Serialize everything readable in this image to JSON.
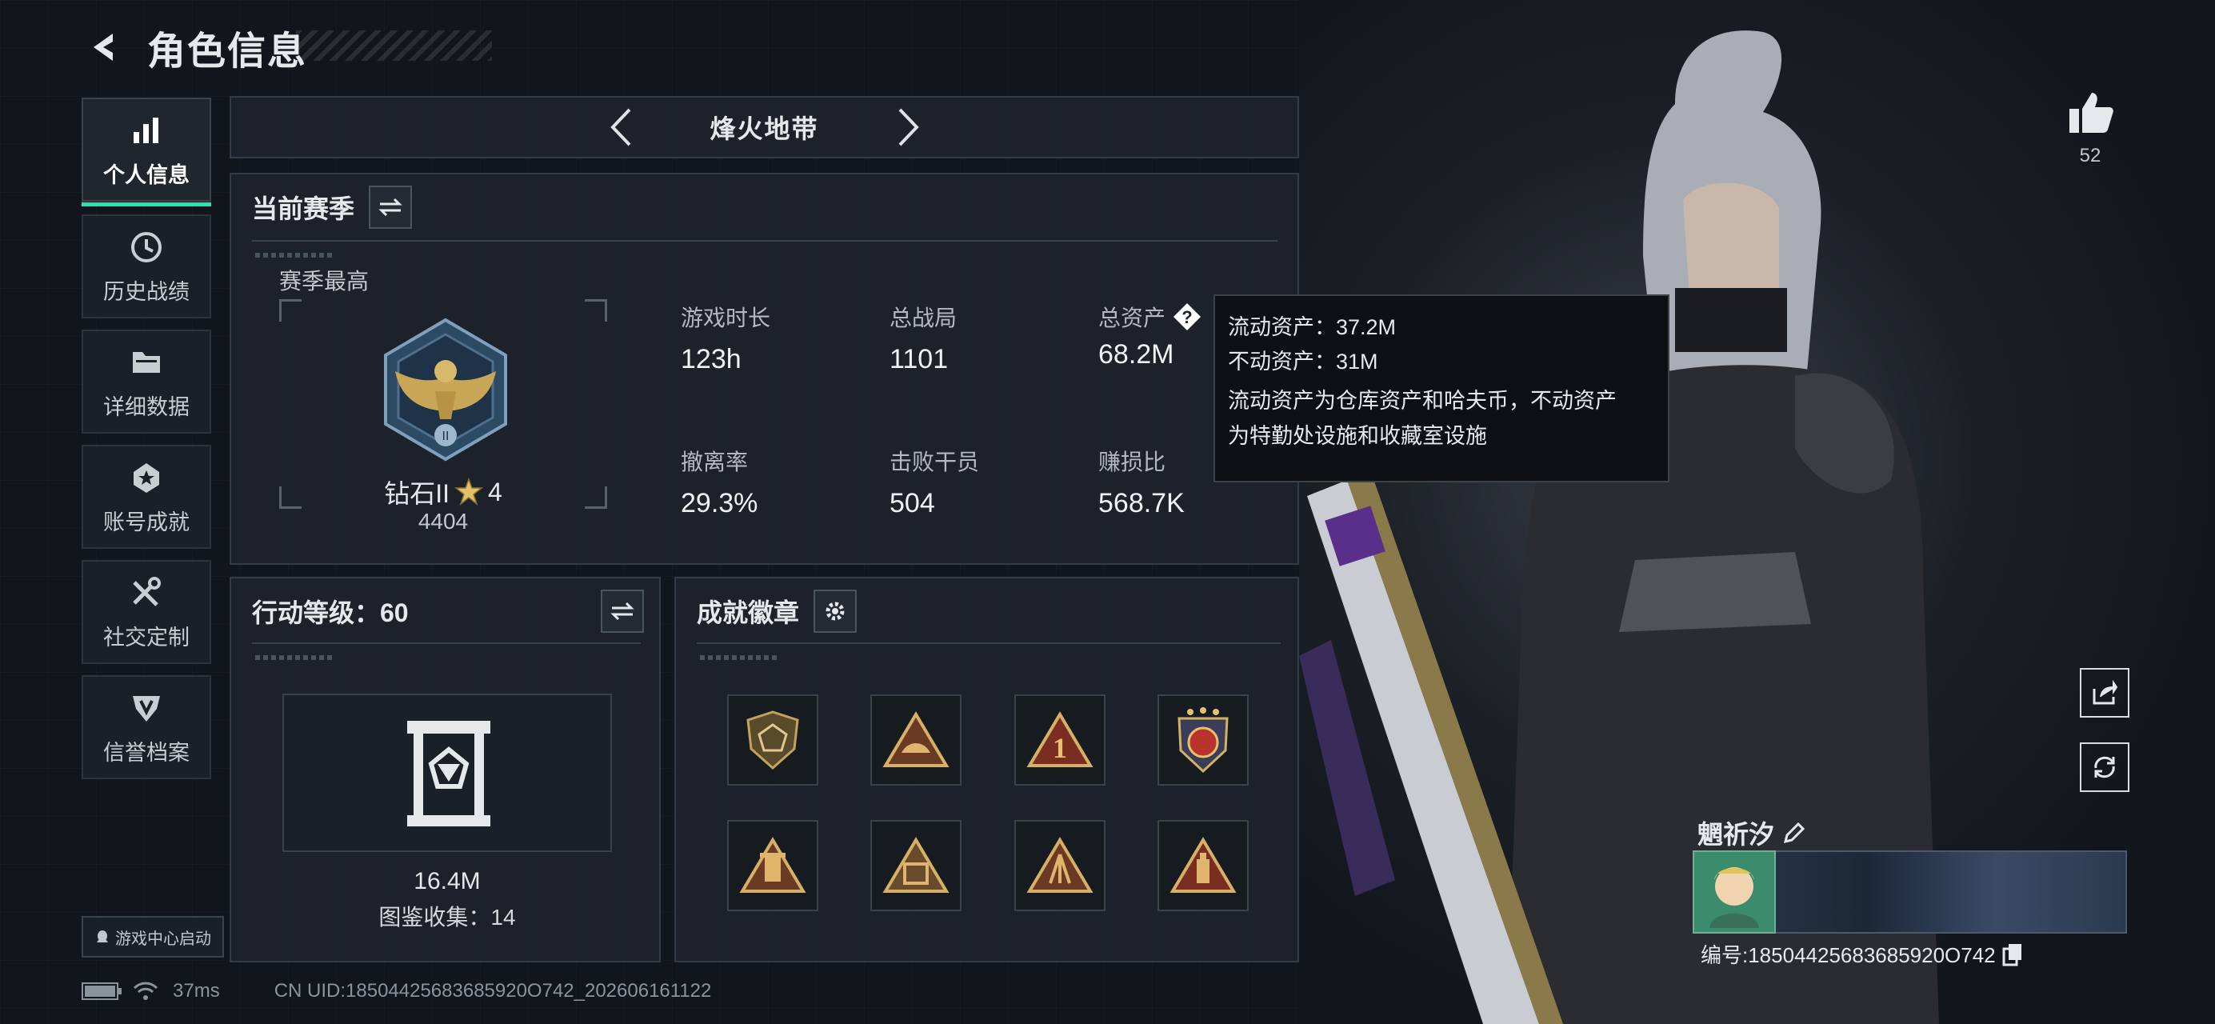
{
  "page": {
    "title": "角色信息"
  },
  "sidebar": {
    "items": [
      {
        "label": "个人信息",
        "icon": "bar-chart-icon",
        "active": true
      },
      {
        "label": "历史战绩",
        "icon": "history-clock-icon"
      },
      {
        "label": "详细数据",
        "icon": "folder-icon"
      },
      {
        "label": "账号成就",
        "icon": "achievement-icon"
      },
      {
        "label": "社交定制",
        "icon": "tools-icon"
      },
      {
        "label": "信誉档案",
        "icon": "credit-shield-icon"
      }
    ],
    "launch_label": "游戏中心启动"
  },
  "status": {
    "ping": "37ms",
    "uid": "CN UID:18504425683685920O742_202606161122"
  },
  "mode": {
    "name": "烽火地带"
  },
  "season": {
    "title": "当前赛季",
    "best_label": "赛季最高",
    "rank_name": "钻石II",
    "rank_stars": "4",
    "rank_score": "4404",
    "stats": [
      {
        "label": "游戏时长",
        "value": "123h"
      },
      {
        "label": "总战局",
        "value": "1101"
      },
      {
        "label": "总资产",
        "value": "68.2M"
      },
      {
        "label": "撤离率",
        "value": "29.3%"
      },
      {
        "label": "击败干员",
        "value": "504"
      },
      {
        "label": "赚损比",
        "value": "568.7K"
      }
    ]
  },
  "tooltip": {
    "line1": "流动资产：37.2M",
    "line2": "不动资产：31M",
    "desc1": "流动资产为仓库资产和哈夫币，不动资产",
    "desc2": "为特勤处设施和收藏室设施"
  },
  "action_level": {
    "title": "行动等级：60",
    "value": "16.4M",
    "collection": "图鉴收集：14"
  },
  "achievements": {
    "title": "成就徽章",
    "badges": [
      "shield-badge-icon",
      "triangle-badge-icon",
      "number-one-badge-icon",
      "star-crest-badge-icon",
      "tower-badge-icon",
      "pyramid-badge-icon",
      "tripod-badge-icon",
      "bottle-badge-icon"
    ]
  },
  "profile": {
    "likes": "52",
    "name": "魍祈汐",
    "id": "编号:18504425683685920O742"
  }
}
